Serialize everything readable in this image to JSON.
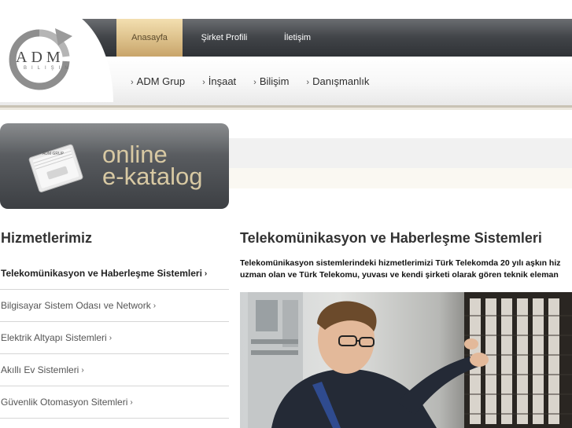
{
  "brand": {
    "logo_text": "ADM",
    "logo_sub": "BILIŞIM"
  },
  "top_nav": [
    {
      "label": "Anasayfa",
      "active": true
    },
    {
      "label": "Şirket Profili",
      "active": false
    },
    {
      "label": "İletişim",
      "active": false
    }
  ],
  "sub_nav": [
    {
      "label": "ADM Grup"
    },
    {
      "label": "İnşaat"
    },
    {
      "label": "Bilişim"
    },
    {
      "label": "Danışmanlık"
    }
  ],
  "katalog": {
    "line1": "online",
    "line2": "e-katalog",
    "book_label": "ADM GRUP"
  },
  "services": {
    "title": "Hizmetlerimiz",
    "items": [
      {
        "label": "Telekomünikasyon ve Haberleşme Sistemleri",
        "active": true
      },
      {
        "label": "Bilgisayar Sistem Odası ve Network",
        "active": false
      },
      {
        "label": "Elektrik Altyapı Sistemleri",
        "active": false
      },
      {
        "label": "Akıllı Ev Sistemleri",
        "active": false
      },
      {
        "label": "Güvenlik Otomasyon Sitemleri",
        "active": false
      }
    ]
  },
  "content": {
    "title": "Telekomünikasyon ve Haberleşme Sistemleri",
    "intro_line1": "Telekomünikasyon sistemlerindeki hizmetlerimizi Türk Telekomda 20 yılı aşkın hiz",
    "intro_line2": "uzman olan ve Türk Telekomu, yuvası ve kendi şirketi olarak gören teknik eleman"
  },
  "colors": {
    "nav_dark": "#3f4246",
    "nav_active": "#dcc08a",
    "katalog_text": "#d8c9a3",
    "divider": "#d6d6d6"
  }
}
